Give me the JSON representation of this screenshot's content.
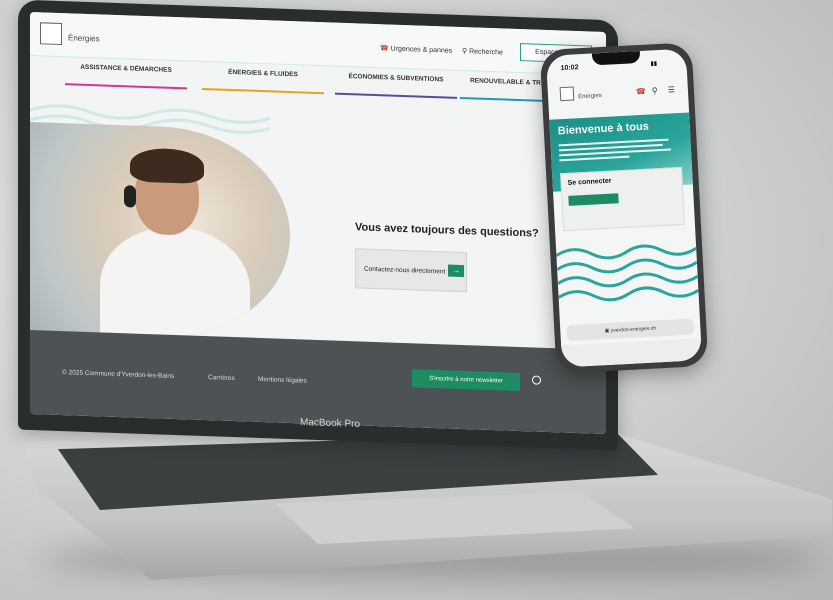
{
  "laptop": {
    "brand": "MacBook Pro",
    "site": {
      "logo_text": "Énergies",
      "utilities": {
        "urgences": "Urgences & pannes",
        "recherche": "Recherche",
        "espace_client": "Espace client"
      },
      "nav": [
        {
          "label": "ASSISTANCE & DÉMARCHES",
          "color": "#d0398f"
        },
        {
          "label": "ÉNERGIES & FLUIDES",
          "color": "#e8a21c"
        },
        {
          "label": "ÉCONOMIES & SUBVENTIONS",
          "color": "#5a4aa3"
        },
        {
          "label": "RENOUVELABLE & TRANSITION",
          "color": "#1f9bb0"
        }
      ],
      "hero": {
        "question": "Vous avez toujours des questions?",
        "cta": "Contactez-nous directement"
      },
      "footer": {
        "copyright": "© 2025 Commune d'Yverdon-les-Bains",
        "careers": "Carrières",
        "legal": "Mentions légales",
        "newsletter": "S'inscrire à notre newsletter"
      }
    }
  },
  "phone": {
    "time": "10:02",
    "logo_text": "Énergies",
    "welcome": "Bienvenue à tous",
    "connect_title": "Se connecter",
    "url": "yverdon-energies.ch"
  },
  "colors": {
    "accent": "#1d8c62",
    "teal": "#2aa59b"
  }
}
